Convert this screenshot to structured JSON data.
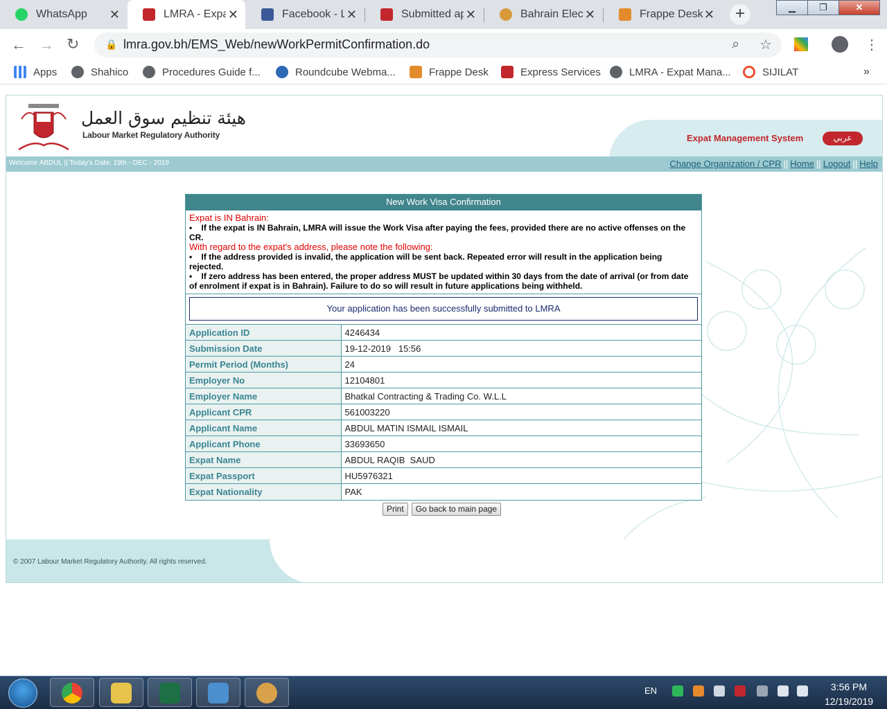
{
  "browser": {
    "tabs": [
      {
        "title": "WhatsApp",
        "icon": "whatsapp-icon",
        "color": "#25d366"
      },
      {
        "title": "LMRA - Expat",
        "icon": "lmra-icon",
        "color": "#c1272d"
      },
      {
        "title": "Facebook - Lo",
        "icon": "facebook-icon",
        "color": "#3b5998"
      },
      {
        "title": "Submitted ap",
        "icon": "lmra-icon",
        "color": "#c1272d"
      },
      {
        "title": "Bahrain Electr",
        "icon": "bahrain-icon",
        "color": "#d99a3a"
      },
      {
        "title": "Frappe Desk",
        "icon": "frappe-icon",
        "color": "#e38b2c"
      }
    ],
    "url": "lmra.gov.bh/EMS_Web/newWorkPermitConfirmation.do",
    "bookmarks": [
      {
        "label": "Apps",
        "icon": "apps-grid-icon",
        "color": "#4285f4"
      },
      {
        "label": "Shahico",
        "icon": "globe-icon",
        "color": "#5f6368"
      },
      {
        "label": "Procedures Guide f...",
        "icon": "globe-icon",
        "color": "#5f6368"
      },
      {
        "label": "Roundcube Webma...",
        "icon": "roundcube-icon",
        "color": "#2f6ab5"
      },
      {
        "label": "Frappe Desk",
        "icon": "frappe-icon",
        "color": "#e38b2c"
      },
      {
        "label": "Express Services",
        "icon": "lmra-icon",
        "color": "#c1272d"
      },
      {
        "label": "LMRA - Expat Mana...",
        "icon": "globe-icon",
        "color": "#5f6368"
      },
      {
        "label": "SIJILAT",
        "icon": "sijilat-icon",
        "color": "#e8502f"
      }
    ]
  },
  "header": {
    "org_arabic": "هيئة تنظيم سوق العمل",
    "org_english": "Labour Market Regulatory Authority",
    "system_name": "Expat Management System",
    "lang_button": "عربي"
  },
  "infobar": {
    "welcome": "Welcome ABDUL  ||  Today's Date: 19th - DEC - 2019",
    "links": [
      "Change Organization / CPR",
      "Home",
      "Logout",
      "Help"
    ],
    "separator": "||"
  },
  "confirmation": {
    "title": "New Work Visa Confirmation",
    "heading1": "Expat is IN Bahrain:",
    "bullet1": "If the expat is IN Bahrain, LMRA will issue the Work Visa after paying the fees, provided there are no active offenses on the CR.",
    "heading2": "With regard to the expat's address, please note the following:",
    "bullet2": "If the address provided is invalid, the application will be sent back. Repeated error will result in the application being rejected.",
    "bullet3": "If zero address has been entered, the proper address MUST be updated within 30 days from the date of arrival (or from date of enrolment if expat is in Bahrain). Failure to do so will result in future applications being withheld.",
    "success": "Your application has been successfully submitted to LMRA",
    "rows": [
      {
        "label": "Application ID",
        "value": "4246434"
      },
      {
        "label": "Submission Date",
        "value": "19-12-2019   15:56"
      },
      {
        "label": "Permit Period (Months)",
        "value": "24"
      },
      {
        "label": "Employer No",
        "value": "12104801"
      },
      {
        "label": "Employer Name",
        "value": "Bhatkal Contracting & Trading Co. W.L.L"
      },
      {
        "label": "Applicant CPR",
        "value": "561003220"
      },
      {
        "label": "Applicant Name",
        "value": "ABDUL MATIN ISMAIL ISMAIL"
      },
      {
        "label": "Applicant Phone",
        "value": "33693650"
      },
      {
        "label": "Expat Name",
        "value": "ABDUL RAQIB  SAUD"
      },
      {
        "label": "Expat Passport",
        "value": "HU5976321"
      },
      {
        "label": "Expat Nationality",
        "value": "PAK"
      }
    ],
    "print_button": "Print",
    "back_button": "Go back to main page"
  },
  "footer": {
    "copyright": "© 2007 Labour Market Regulatory Authority. All rights reserved."
  },
  "taskbar": {
    "language": "EN",
    "time": "3:56 PM",
    "date": "12/19/2019",
    "apps": [
      {
        "name": "chrome-icon",
        "color": "#4285f4"
      },
      {
        "name": "file-explorer-icon",
        "color": "#e8c34b"
      },
      {
        "name": "excel-icon",
        "color": "#1d7044"
      },
      {
        "name": "photo-viewer-icon",
        "color": "#4b8fcf"
      },
      {
        "name": "paint-icon",
        "color": "#d9a24a"
      }
    ]
  },
  "colors": {
    "brand_teal": "#41858d",
    "brand_red": "#c1272d",
    "label_teal": "#3a8591"
  }
}
